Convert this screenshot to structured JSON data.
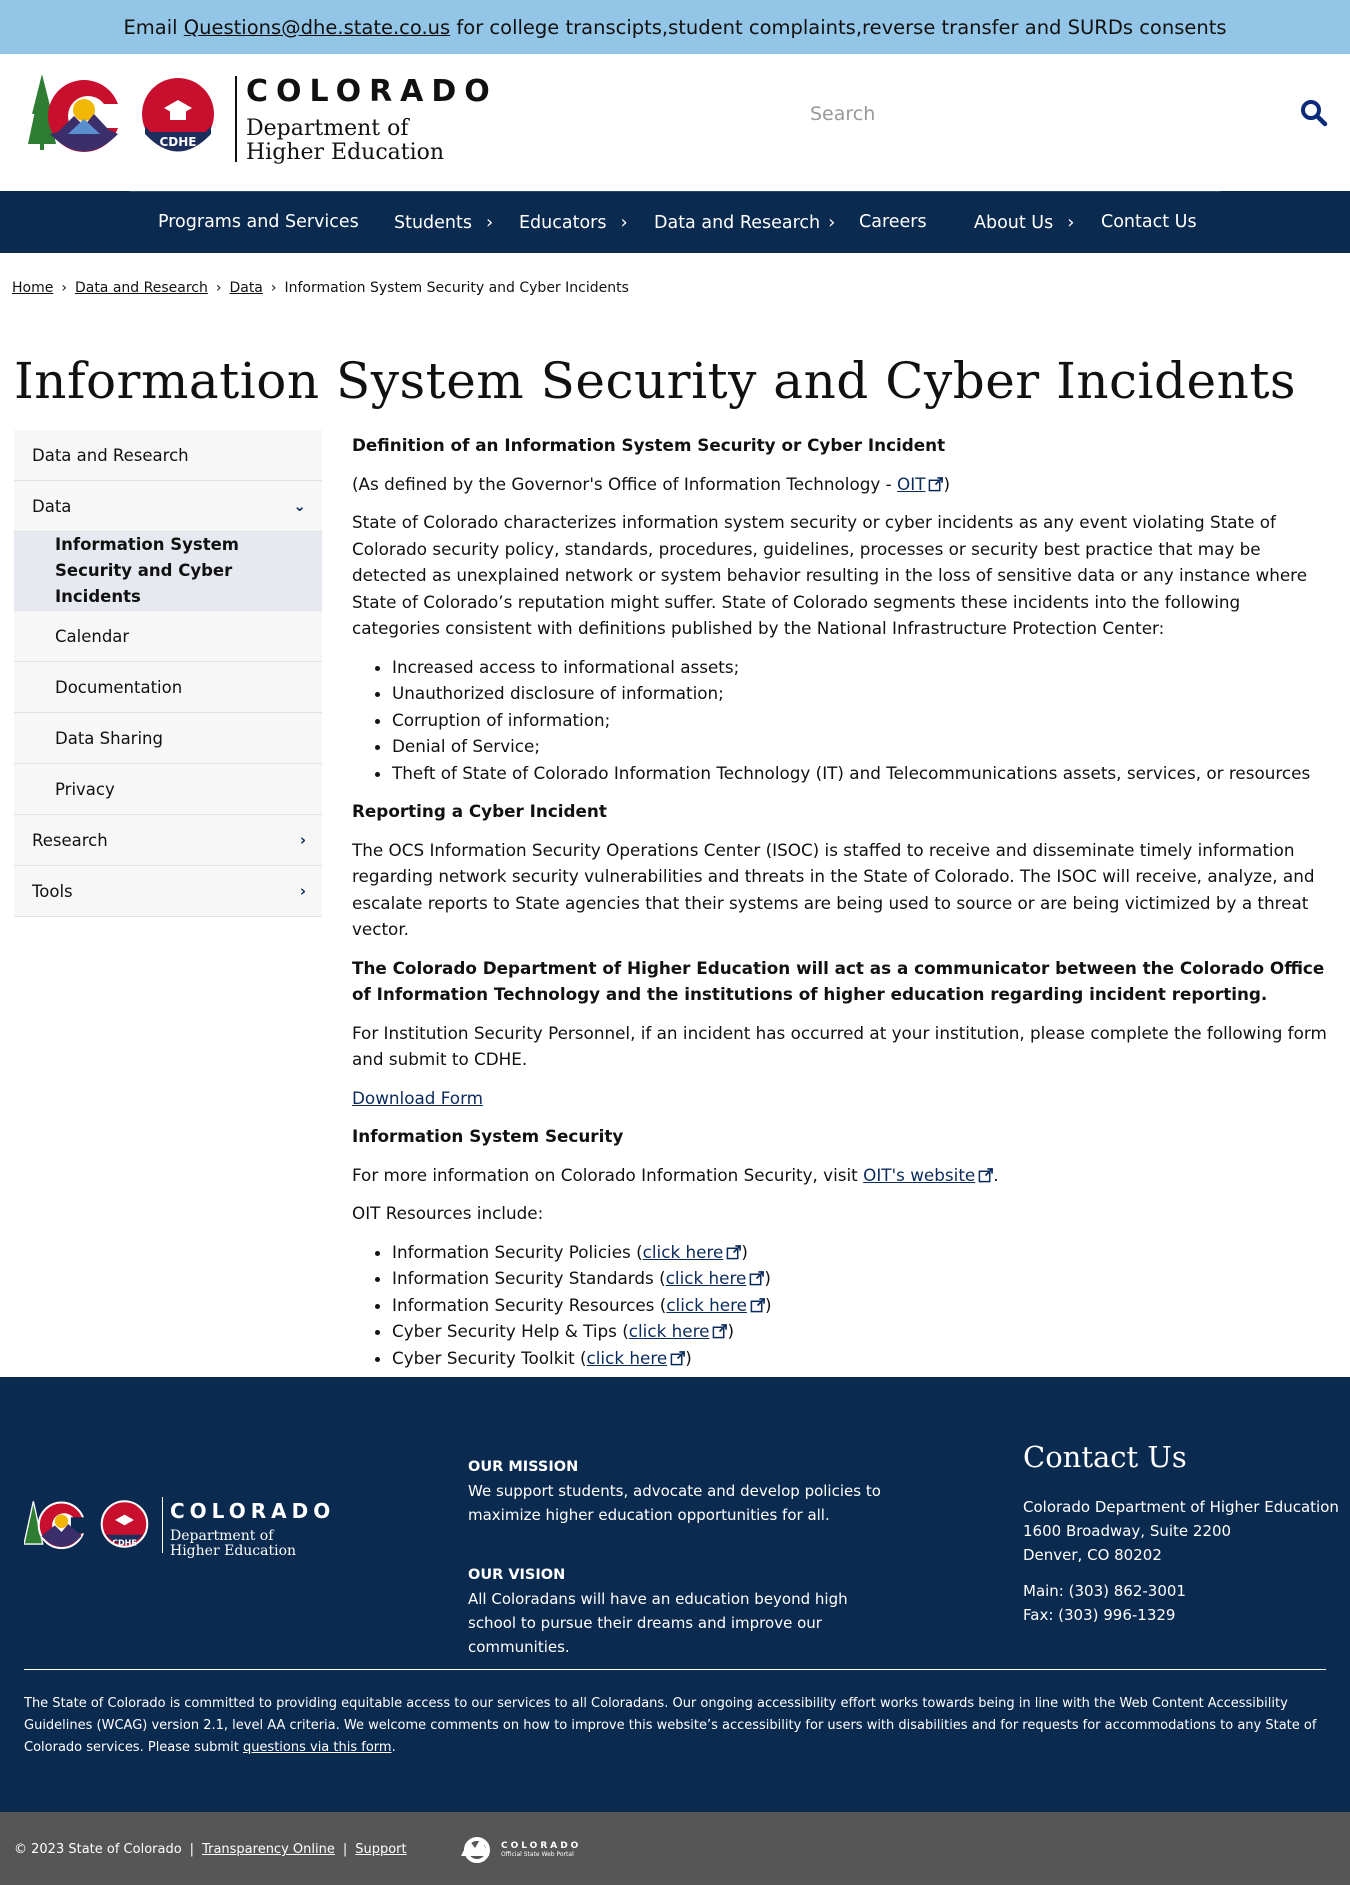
{
  "alert": {
    "prefix": "Email ",
    "email": "Questions@dhe.state.co.us",
    "suffix": " for college transcipts,student complaints,reverse transfer and SURDs consents"
  },
  "header": {
    "logo_colorado": "COLORADO",
    "logo_dept_line1": "Department of",
    "logo_dept_line2": "Higher Education",
    "logo_badge": "CDHE",
    "search_placeholder": "Search",
    "colors": {
      "brand_navy": "#0b2a50",
      "alert_blue": "#93c5e6",
      "logo_red": "#c8102e",
      "logo_green": "#2e7d32"
    }
  },
  "nav": {
    "items": [
      {
        "label": "Programs and Services",
        "has_submenu": false
      },
      {
        "label": "Students",
        "has_submenu": true
      },
      {
        "label": "Educators",
        "has_submenu": true
      },
      {
        "label": "Data and Research",
        "has_submenu": true
      },
      {
        "label": "Careers",
        "has_submenu": false
      },
      {
        "label": "About Us",
        "has_submenu": true
      },
      {
        "label": "Contact Us",
        "has_submenu": false
      }
    ]
  },
  "breadcrumb": {
    "items": [
      "Home",
      "Data and Research",
      "Data"
    ],
    "current": "Information System Security and Cyber Incidents",
    "separator": "›"
  },
  "page_title": "Information System Security and Cyber Incidents",
  "sidebar": {
    "items": [
      {
        "label": "Data and Research"
      },
      {
        "label": "Data",
        "expanded": true
      },
      {
        "label": "Information System Security and Cyber Incidents",
        "active": true
      },
      {
        "label": "Calendar"
      },
      {
        "label": "Documentation"
      },
      {
        "label": "Data Sharing"
      },
      {
        "label": "Privacy"
      },
      {
        "label": "Research"
      },
      {
        "label": "Tools"
      }
    ]
  },
  "content": {
    "definition_heading": "Definition of an Information System Security or Cyber Incident",
    "defined_by_prefix": "(As defined by the Governor's Office of Information Technology - ",
    "defined_by_link": "OIT",
    "defined_by_suffix": ")",
    "intro": "State of Colorado characterizes information system security or cyber incidents as any event violating State of Colorado security policy, standards, procedures, guidelines, processes or security best practice that may be detected as unexplained network or system behavior resulting in the loss of sensitive data or any instance where State of Colorado’s reputation might suffer. State of Colorado segments these incidents into the following categories consistent with definitions published by the National Infrastructure Protection Center:",
    "categories": [
      "Increased access to informational assets;",
      "Unauthorized disclosure of information;",
      "Corruption of information;",
      "Denial of Service;",
      "Theft of State of Colorado Information Technology (IT) and Telecommunications assets, services, or resources"
    ],
    "reporting_heading": "Reporting a Cyber Incident",
    "reporting_text": "The OCS Information Security Operations Center (ISOC) is staffed to receive and disseminate timely information regarding network security vulnerabilities and threats in the State of Colorado. The ISOC will receive, analyze, and escalate reports to State agencies that their systems are being used to source or are being victimized by a threat vector.",
    "communicator_text": "The Colorado Department of Higher Education will act as a communicator between the Colorado Office of Information Technology and the institutions of higher education regarding incident reporting.",
    "institution_text": "For Institution Security Personnel, if an incident has occurred at your institution, please complete the following form and submit to CDHE.",
    "download_link": "Download Form",
    "iss_heading": "Information System Security",
    "more_info_prefix": "For more information on Colorado Information Security, visit ",
    "more_info_link": "OIT's website",
    "more_info_suffix": ".",
    "resources_intro": "OIT Resources include:",
    "resources": [
      {
        "label": "Information Security Policies (",
        "link": "click here",
        "close": ")"
      },
      {
        "label": "Information Security Standards (",
        "link": "click here",
        "close": ")"
      },
      {
        "label": "Information Security Resources (",
        "link": "click here",
        "close": ")"
      },
      {
        "label": "Cyber Security Help & Tips (",
        "link": "click here",
        "close": ")"
      },
      {
        "label": "Cyber Security Toolkit (",
        "link": "click here",
        "close": ")"
      }
    ]
  },
  "footer": {
    "logo_colorado": "COLORADO",
    "logo_dept_line1": "Department of",
    "logo_dept_line2": "Higher Education",
    "logo_badge": "CDHE",
    "mission_heading": "OUR MISSION",
    "mission_text": "We support students, advocate and develop policies to maximize higher education opportunities for all.",
    "vision_heading": "OUR VISION",
    "vision_text": "All Coloradans will have an education beyond high school to pursue their dreams and improve our communities.",
    "contact_heading": "Contact Us",
    "contact_org": "Colorado Department of Higher Education",
    "contact_street": "1600 Broadway, Suite 2200",
    "contact_city": "Denver, CO 80202",
    "contact_main": "Main: (303) 862-3001",
    "contact_fax": "Fax: (303) 996-1329",
    "accessibility_text": "The State of Colorado is committed to providing equitable access to our services to all Coloradans. Our ongoing accessibility effort works towards being in line with the Web Content Accessibility Guidelines (WCAG) version 2.1, level AA criteria. We welcome comments on how to improve this website’s accessibility for users with disabilities and for requests for accommodations to any State of Colorado services. Please submit ",
    "accessibility_link": "questions via this form",
    "accessibility_end": "."
  },
  "bottom_bar": {
    "copyright": "© 2023 State of Colorado",
    "sep": "|",
    "transparency": "Transparency Online",
    "support": "Support",
    "portal_colorado": "COLORADO",
    "portal_sub": "Official State Web Portal"
  }
}
